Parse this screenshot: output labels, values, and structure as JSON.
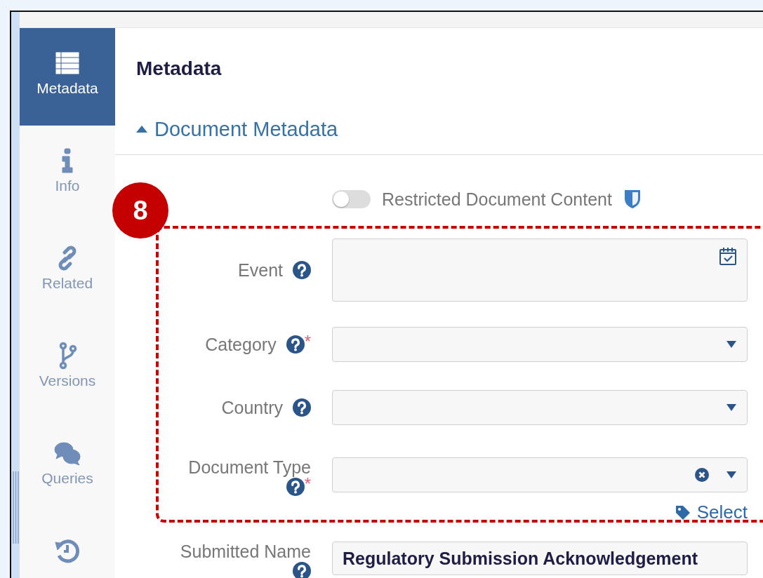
{
  "sidebar": {
    "items": [
      {
        "kind": "list",
        "label": "Metadata",
        "selected": true
      },
      {
        "kind": "info",
        "label": "Info",
        "selected": false
      },
      {
        "kind": "link",
        "label": "Related",
        "selected": false
      },
      {
        "kind": "branch",
        "label": "Versions",
        "selected": false
      },
      {
        "kind": "chat",
        "label": "Queries",
        "selected": false
      },
      {
        "kind": "history",
        "selected": false
      }
    ]
  },
  "page_title": "Metadata",
  "section": {
    "title": "Document Metadata",
    "expanded": true
  },
  "restricted_toggle": {
    "label": "Restricted Document Content",
    "on": false
  },
  "annotation": {
    "label": "8"
  },
  "fields": [
    {
      "kind": "date",
      "label": "Event"
    },
    {
      "kind": "select",
      "label": "Category",
      "required_mark": "*"
    },
    {
      "kind": "select",
      "label": "Country"
    },
    {
      "kind": "select_clearable",
      "label": "Document Type",
      "required_mark": "*",
      "link": "Select"
    },
    {
      "kind": "text",
      "label": "Submitted Name",
      "value": "Regulatory Submission Acknowledgement"
    }
  ]
}
